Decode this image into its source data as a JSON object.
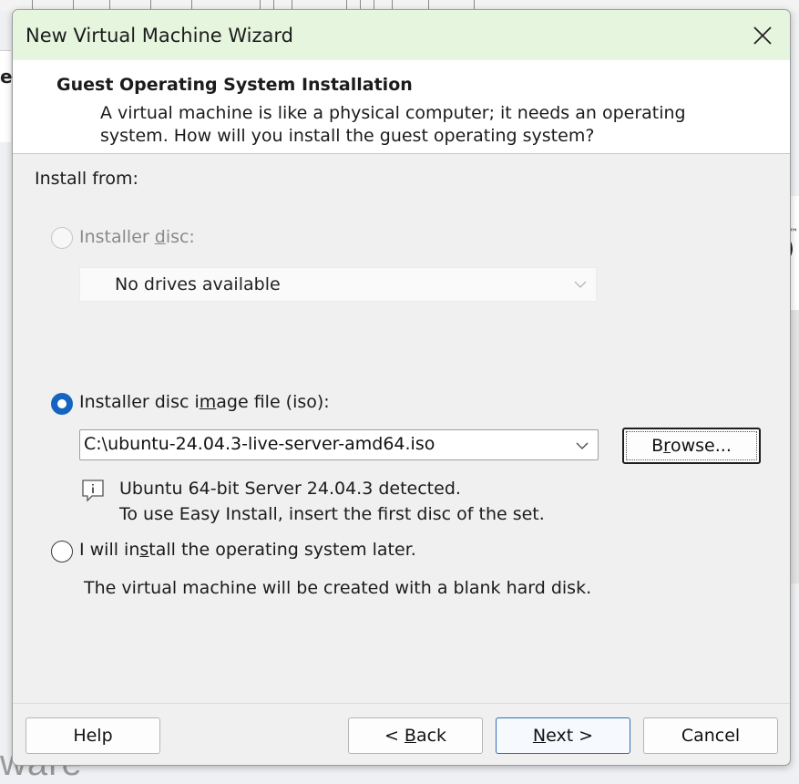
{
  "window": {
    "title": "New Virtual Machine Wizard"
  },
  "header": {
    "title": "Guest Operating System Installation",
    "description": "A virtual machine is like a physical computer; it needs an operating system. How will you install the guest operating system?"
  },
  "install_from_label": "Install from:",
  "options": {
    "disc": {
      "label_pre": "Installer ",
      "label_ul": "d",
      "label_post": "isc:",
      "dropdown_value": "No drives available",
      "enabled": false,
      "selected": false
    },
    "iso": {
      "label_pre": "Installer disc i",
      "label_ul": "m",
      "label_post": "age file (iso):",
      "path": "C:\\ubuntu-24.04.3-live-server-amd64.iso",
      "browse_pre": "B",
      "browse_ul": "r",
      "browse_post": "owse...",
      "selected": true,
      "info_line1": "Ubuntu 64-bit Server 24.04.3 detected.",
      "info_line2": "To use Easy Install, insert the first disc of the set."
    },
    "later": {
      "label_pre": "I will in",
      "label_ul": "s",
      "label_post": "tall the operating system later.",
      "description": "The virtual machine will be created with a blank hard disk.",
      "selected": false
    }
  },
  "footer": {
    "help": "Help",
    "back_pre": "< ",
    "back_ul": "B",
    "back_post": "ack",
    "next_ul": "N",
    "next_post": "ext >",
    "cancel": "Cancel"
  },
  "background": {
    "partial_text": "e",
    "tm_mark": "™",
    "paren": ")",
    "brand_fragment": "ware"
  },
  "colors": {
    "titlebar": "#e6f5de",
    "accent": "#1565c0"
  }
}
